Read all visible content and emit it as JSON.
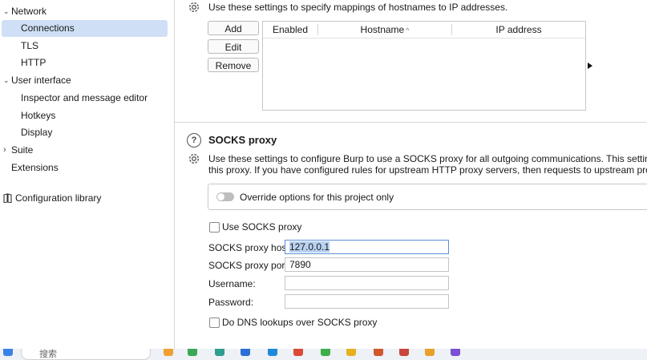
{
  "sidebar": {
    "items": [
      {
        "label": "Network",
        "expanded": true
      },
      {
        "label": "Connections",
        "selected": true
      },
      {
        "label": "TLS"
      },
      {
        "label": "HTTP"
      },
      {
        "label": "User interface",
        "expanded": true
      },
      {
        "label": "Inspector and message editor"
      },
      {
        "label": "Hotkeys"
      },
      {
        "label": "Display"
      },
      {
        "label": "Suite",
        "expanded": false
      },
      {
        "label": "Extensions"
      }
    ],
    "library_label": "Configuration library"
  },
  "hostname_resolution": {
    "description": "Use these settings to specify mappings of hostnames to IP addresses.",
    "buttons": {
      "add": "Add",
      "edit": "Edit",
      "remove": "Remove"
    },
    "columns": {
      "enabled": "Enabled",
      "hostname": "Hostname",
      "ip": "IP address"
    },
    "sort_indicator": "^"
  },
  "socks": {
    "title": "SOCKS proxy",
    "description_line1": "Use these settings to configure Burp to use a SOCKS proxy for all outgoing communications. This setting is ap",
    "description_line2": "this proxy. If you have configured rules for upstream HTTP proxy servers, then requests to upstream proxies w",
    "override_label": "Override options for this project only",
    "use_socks_label": "Use SOCKS proxy",
    "host_label": "SOCKS proxy host:",
    "host_value": "127.0.0.1",
    "port_label": "SOCKS proxy port:",
    "port_value": "7890",
    "username_label": "Username:",
    "username_value": "",
    "password_label": "Password:",
    "password_value": "",
    "dns_label": "Do DNS lookups over SOCKS proxy"
  },
  "taskbar": {
    "search_placeholder": "搜索"
  },
  "colors": {
    "selected_nav": "#cfdff5",
    "focus_border": "#5c8fd6",
    "text_selection": "#b8d1f1"
  }
}
